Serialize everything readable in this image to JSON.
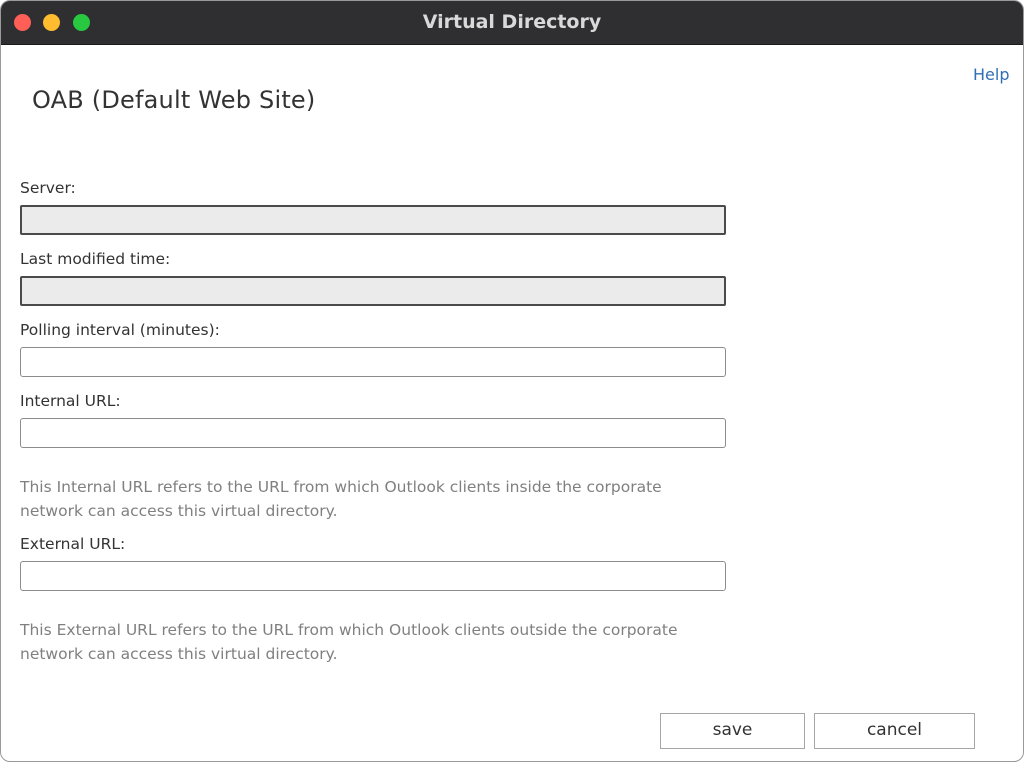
{
  "window": {
    "title": "Virtual Directory"
  },
  "header": {
    "help_label": "Help",
    "page_title": "OAB (Default Web Site)"
  },
  "form": {
    "server": {
      "label": "Server:",
      "value": ""
    },
    "last_modified": {
      "label": "Last modified time:",
      "value": ""
    },
    "polling_interval": {
      "label": "Polling interval (minutes):",
      "value": ""
    },
    "internal_url": {
      "label": "Internal URL:",
      "value": "",
      "hint": "This Internal URL refers to the URL from which Outlook clients inside the corporate network can access this virtual directory."
    },
    "external_url": {
      "label": "External URL:",
      "value": "",
      "hint": "This External URL refers to the URL from which Outlook clients outside the corporate network can access this virtual directory."
    }
  },
  "footer": {
    "save_label": "save",
    "cancel_label": "cancel"
  },
  "colors": {
    "titlebar": "#2f2f31",
    "close": "#ff5f57",
    "minimize": "#febc2e",
    "zoom": "#28c840",
    "link": "#2f6fb5",
    "hint": "#808080"
  }
}
